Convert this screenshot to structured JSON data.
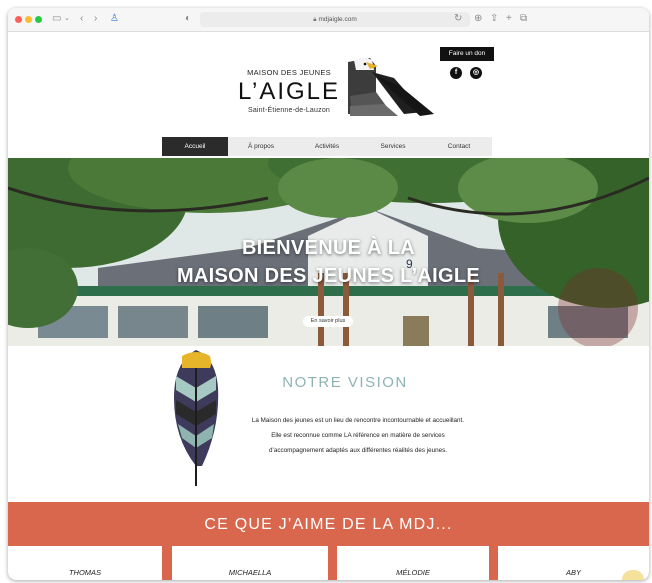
{
  "browser": {
    "url": "mdjaigle.com"
  },
  "header": {
    "logo_top": "MAISON DES JEUNES",
    "logo_main": "L’AIGLE",
    "logo_bottom": "Saint-Étienne-de-Lauzon",
    "donate_label": "Faire un don",
    "social": [
      {
        "icon": "facebook-icon",
        "glyph": "f"
      },
      {
        "icon": "instagram-icon",
        "glyph": "◎"
      }
    ]
  },
  "nav": {
    "items": [
      {
        "label": "Accueil",
        "active": true
      },
      {
        "label": "À propos",
        "active": false
      },
      {
        "label": "Activités",
        "active": false
      },
      {
        "label": "Services",
        "active": false
      },
      {
        "label": "Contact",
        "active": false
      }
    ]
  },
  "hero": {
    "title_line1": "BIENVENUE À LA",
    "title_line2": "MAISON DES JEUNES L’AIGLE",
    "button_label": "En savoir plus",
    "house_number": "9"
  },
  "vision": {
    "title": "NOTRE VISION",
    "line1": "La Maison des jeunes est un lieu de rencontre incontournable et accueillant.",
    "line2": "Elle est reconnue comme LA référence en matière de services",
    "line3": "d’accompagnement adaptés aux différentes réalités des jeunes."
  },
  "testimonials": {
    "title": "CE QUE J’AIME DE LA MDJ...",
    "names": [
      "THOMAS",
      "MICHAELLA",
      "MÉLODIE",
      "ABY"
    ]
  },
  "colors": {
    "accent": "#d8674d",
    "vision_title": "#8fb3b3",
    "nav_active": "#2b2b2b"
  }
}
